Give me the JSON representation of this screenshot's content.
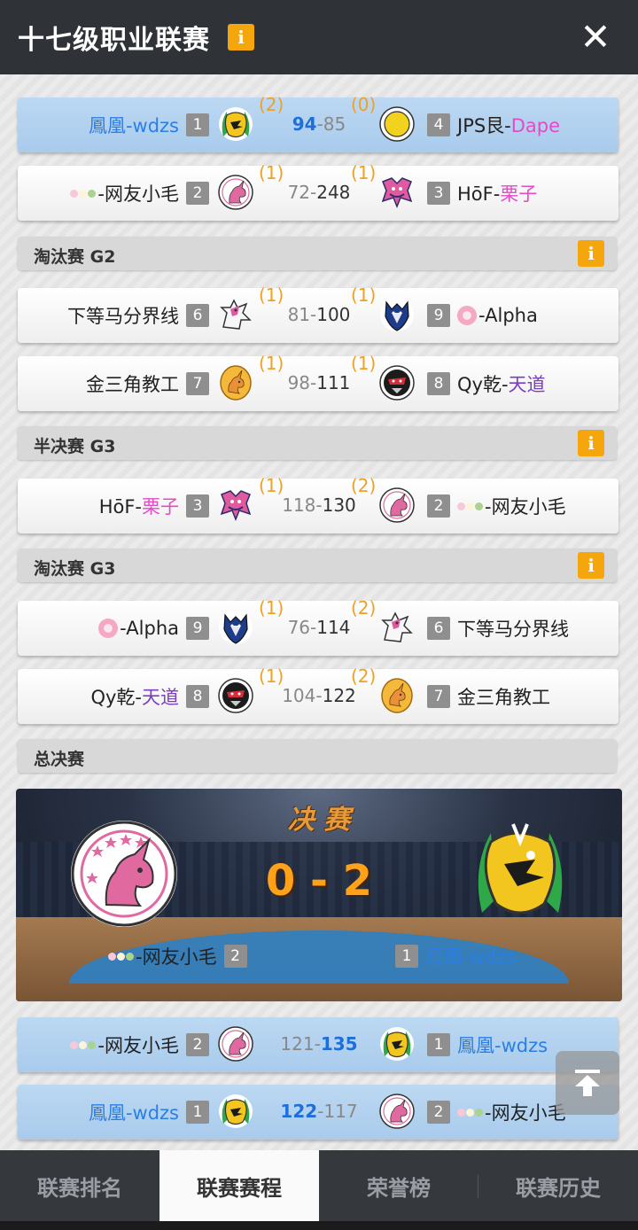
{
  "header": {
    "title": "十七级职业联赛",
    "info_icon": "i",
    "close_icon": "✕"
  },
  "matches": [
    {
      "highlight": true,
      "left": {
        "prefix": "",
        "name_parts": [
          {
            "text": "鳳凰-wdzs",
            "color": "blue"
          }
        ],
        "seed": "1",
        "logo": "dragon-logo"
      },
      "left_series": "(2)",
      "score_left": "94",
      "score_sep": "-",
      "score_right": "85",
      "winner": "left",
      "right_series": "(0)",
      "right": {
        "prefix": "",
        "name_parts": [
          {
            "text": "JPS艮-",
            "color": "black"
          },
          {
            "text": "Dape",
            "color": "pink"
          }
        ],
        "seed": "4",
        "logo": "yellow-circle-logo"
      }
    },
    {
      "highlight": false,
      "left": {
        "prefix": "dango",
        "name_parts": [
          {
            "text": "-网友小毛",
            "color": "black"
          }
        ],
        "seed": "2",
        "logo": "unicorn-logo"
      },
      "left_series": "(1)",
      "score_left": "72",
      "score_sep": "-",
      "score_right": "248",
      "winner": "right",
      "right_series": "(1)",
      "right": {
        "prefix": "",
        "name_parts": [
          {
            "text": "HōF-",
            "color": "black"
          },
          {
            "text": "栗子",
            "color": "pink"
          }
        ],
        "seed": "3",
        "logo": "pink-beast-logo"
      }
    },
    {
      "highlight": false,
      "left": {
        "prefix": "",
        "name_parts": [
          {
            "text": "下等马分界线",
            "color": "black"
          }
        ],
        "seed": "6",
        "logo": "pink-horse-logo"
      },
      "left_series": "(1)",
      "score_left": "81",
      "score_sep": "-",
      "score_right": "100",
      "winner": "right",
      "right_series": "(1)",
      "right": {
        "prefix": "flower",
        "name_parts": [
          {
            "text": "-Alpha",
            "color": "black"
          }
        ],
        "seed": "9",
        "logo": "wolf-logo"
      }
    },
    {
      "highlight": false,
      "left": {
        "prefix": "",
        "name_parts": [
          {
            "text": "金三角教工",
            "color": "black"
          }
        ],
        "seed": "7",
        "logo": "gold-unicorn-logo"
      },
      "left_series": "(1)",
      "score_left": "98",
      "score_sep": "-",
      "score_right": "111",
      "winner": "right",
      "right_series": "(1)",
      "right": {
        "prefix": "",
        "name_parts": [
          {
            "text": "Qy乾-",
            "color": "black"
          },
          {
            "text": "天道",
            "color": "purple"
          }
        ],
        "seed": "8",
        "logo": "ninja-logo"
      }
    },
    {
      "highlight": false,
      "left": {
        "prefix": "",
        "name_parts": [
          {
            "text": "HōF-",
            "color": "black"
          },
          {
            "text": "栗子",
            "color": "pink"
          }
        ],
        "seed": "3",
        "logo": "pink-beast-logo"
      },
      "left_series": "(1)",
      "score_left": "118",
      "score_sep": "-",
      "score_right": "130",
      "winner": "right",
      "right_series": "(2)",
      "right": {
        "prefix": "dango",
        "name_parts": [
          {
            "text": "-网友小毛",
            "color": "black"
          }
        ],
        "seed": "2",
        "logo": "unicorn-logo"
      }
    },
    {
      "highlight": false,
      "left": {
        "prefix": "flower",
        "name_parts": [
          {
            "text": "-Alpha",
            "color": "black"
          }
        ],
        "seed": "9",
        "logo": "wolf-logo"
      },
      "left_series": "(1)",
      "score_left": "76",
      "score_sep": "-",
      "score_right": "114",
      "winner": "right",
      "right_series": "(2)",
      "right": {
        "prefix": "",
        "name_parts": [
          {
            "text": "下等马分界线",
            "color": "black"
          }
        ],
        "seed": "6",
        "logo": "pink-horse-logo"
      }
    },
    {
      "highlight": false,
      "left": {
        "prefix": "",
        "name_parts": [
          {
            "text": "Qy乾-",
            "color": "black"
          },
          {
            "text": "天道",
            "color": "purple"
          }
        ],
        "seed": "8",
        "logo": "ninja-logo"
      },
      "left_series": "(1)",
      "score_left": "104",
      "score_sep": "-",
      "score_right": "122",
      "winner": "right",
      "right_series": "(2)",
      "right": {
        "prefix": "",
        "name_parts": [
          {
            "text": "金三角教工",
            "color": "black"
          }
        ],
        "seed": "7",
        "logo": "gold-unicorn-logo"
      }
    },
    {
      "highlight": true,
      "left": {
        "prefix": "dango",
        "name_parts": [
          {
            "text": "-网友小毛",
            "color": "black"
          }
        ],
        "seed": "2",
        "logo": "unicorn-logo"
      },
      "left_series": "",
      "score_left": "121",
      "score_sep": "-",
      "score_right": "135",
      "winner": "right",
      "right_series": "",
      "right": {
        "prefix": "",
        "name_parts": [
          {
            "text": "鳳凰-wdzs",
            "color": "blue"
          }
        ],
        "seed": "1",
        "logo": "dragon-logo"
      }
    },
    {
      "highlight": true,
      "left": {
        "prefix": "",
        "name_parts": [
          {
            "text": "鳳凰-wdzs",
            "color": "blue"
          }
        ],
        "seed": "1",
        "logo": "dragon-logo"
      },
      "left_series": "",
      "score_left": "122",
      "score_sep": "-",
      "score_right": "117",
      "winner": "left",
      "right_series": "",
      "right": {
        "prefix": "dango",
        "name_parts": [
          {
            "text": "-网友小毛",
            "color": "black"
          }
        ],
        "seed": "2",
        "logo": "unicorn-logo"
      }
    }
  ],
  "sections": [
    {
      "label": "淘汰赛 G2",
      "has_info": true
    },
    {
      "label": "半决赛 G3",
      "has_info": true
    },
    {
      "label": "淘汰赛 G3",
      "has_info": true
    },
    {
      "label": "总决赛",
      "has_info": false
    }
  ],
  "final": {
    "title": "决 赛",
    "score": "0 - 2",
    "left_team": "-网友小毛",
    "left_seed": "2",
    "right_team": "鳳凰-wdzs",
    "right_seed": "1"
  },
  "scroll_top_icon": "arrow-up-to-top-icon",
  "nav": {
    "tabs": [
      "联赛排名",
      "联赛赛程",
      "荣誉榜",
      "联赛历史"
    ],
    "active_index": 1
  },
  "colors": {
    "accent_orange": "#f5a60c",
    "winner_blue": "#1f6fd9",
    "name_blue": "#2a7fe6",
    "name_pink": "#e44bc9",
    "name_purple": "#7a3fbd",
    "series_orange": "#f0a024"
  }
}
